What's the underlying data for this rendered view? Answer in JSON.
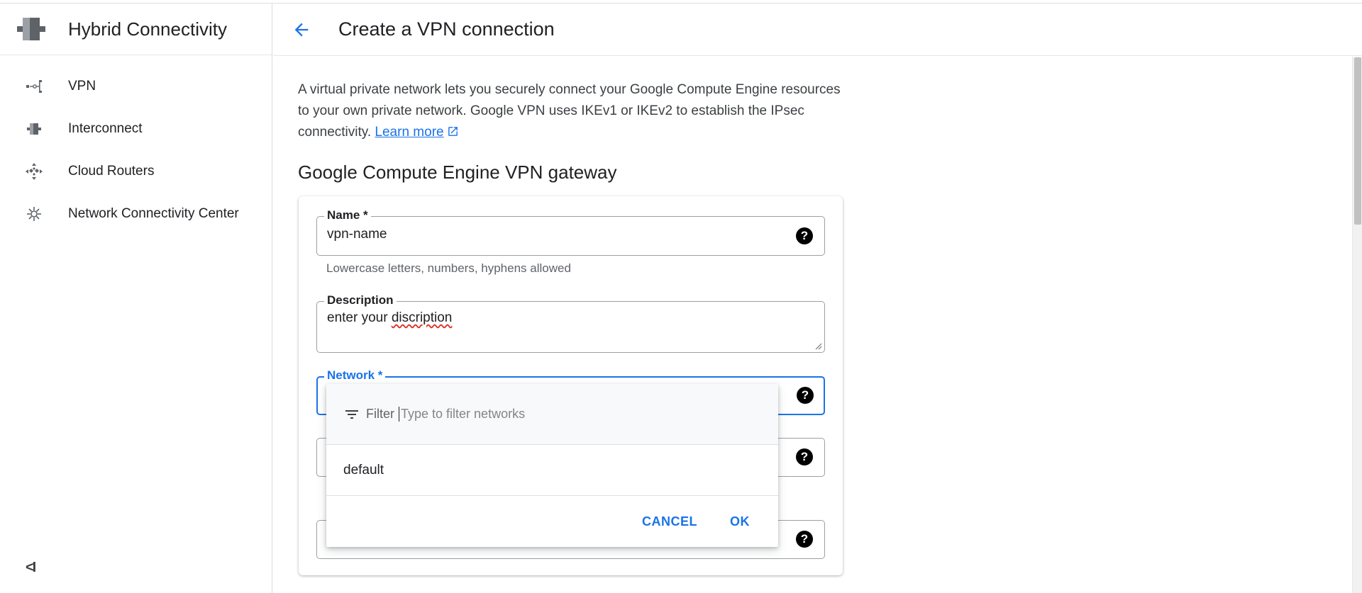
{
  "sidebar": {
    "product_title": "Hybrid Connectivity",
    "items": [
      {
        "label": "VPN",
        "icon": "vpn-icon"
      },
      {
        "label": "Interconnect",
        "icon": "interconnect-icon"
      },
      {
        "label": "Cloud Routers",
        "icon": "cloud-router-icon"
      },
      {
        "label": "Network Connectivity Center",
        "icon": "hub-icon"
      }
    ],
    "collapse_label": "<I"
  },
  "header": {
    "title": "Create a VPN connection"
  },
  "intro": {
    "text": "A virtual private network lets you securely connect your Google Compute Engine resources to your own private network. Google VPN uses IKEv1 or IKEv2 to establish the IPsec connectivity.",
    "link_label": "Learn more"
  },
  "gateway": {
    "section_title": "Google Compute Engine VPN gateway",
    "name": {
      "label": "Name *",
      "value": "vpn-name",
      "hint": "Lowercase letters, numbers, hyphens allowed"
    },
    "description": {
      "label": "Description",
      "value_prefix": "enter your ",
      "value_misspelled": "discription"
    },
    "network": {
      "label": "Network *"
    }
  },
  "dropdown": {
    "filter_label": "Filter",
    "filter_placeholder": "Type to filter networks",
    "options": [
      "default"
    ],
    "cancel_label": "CANCEL",
    "ok_label": "OK"
  },
  "help_glyph": "?",
  "colors": {
    "accent": "#1a73e8",
    "text": "#202124",
    "muted": "#5f6368"
  }
}
